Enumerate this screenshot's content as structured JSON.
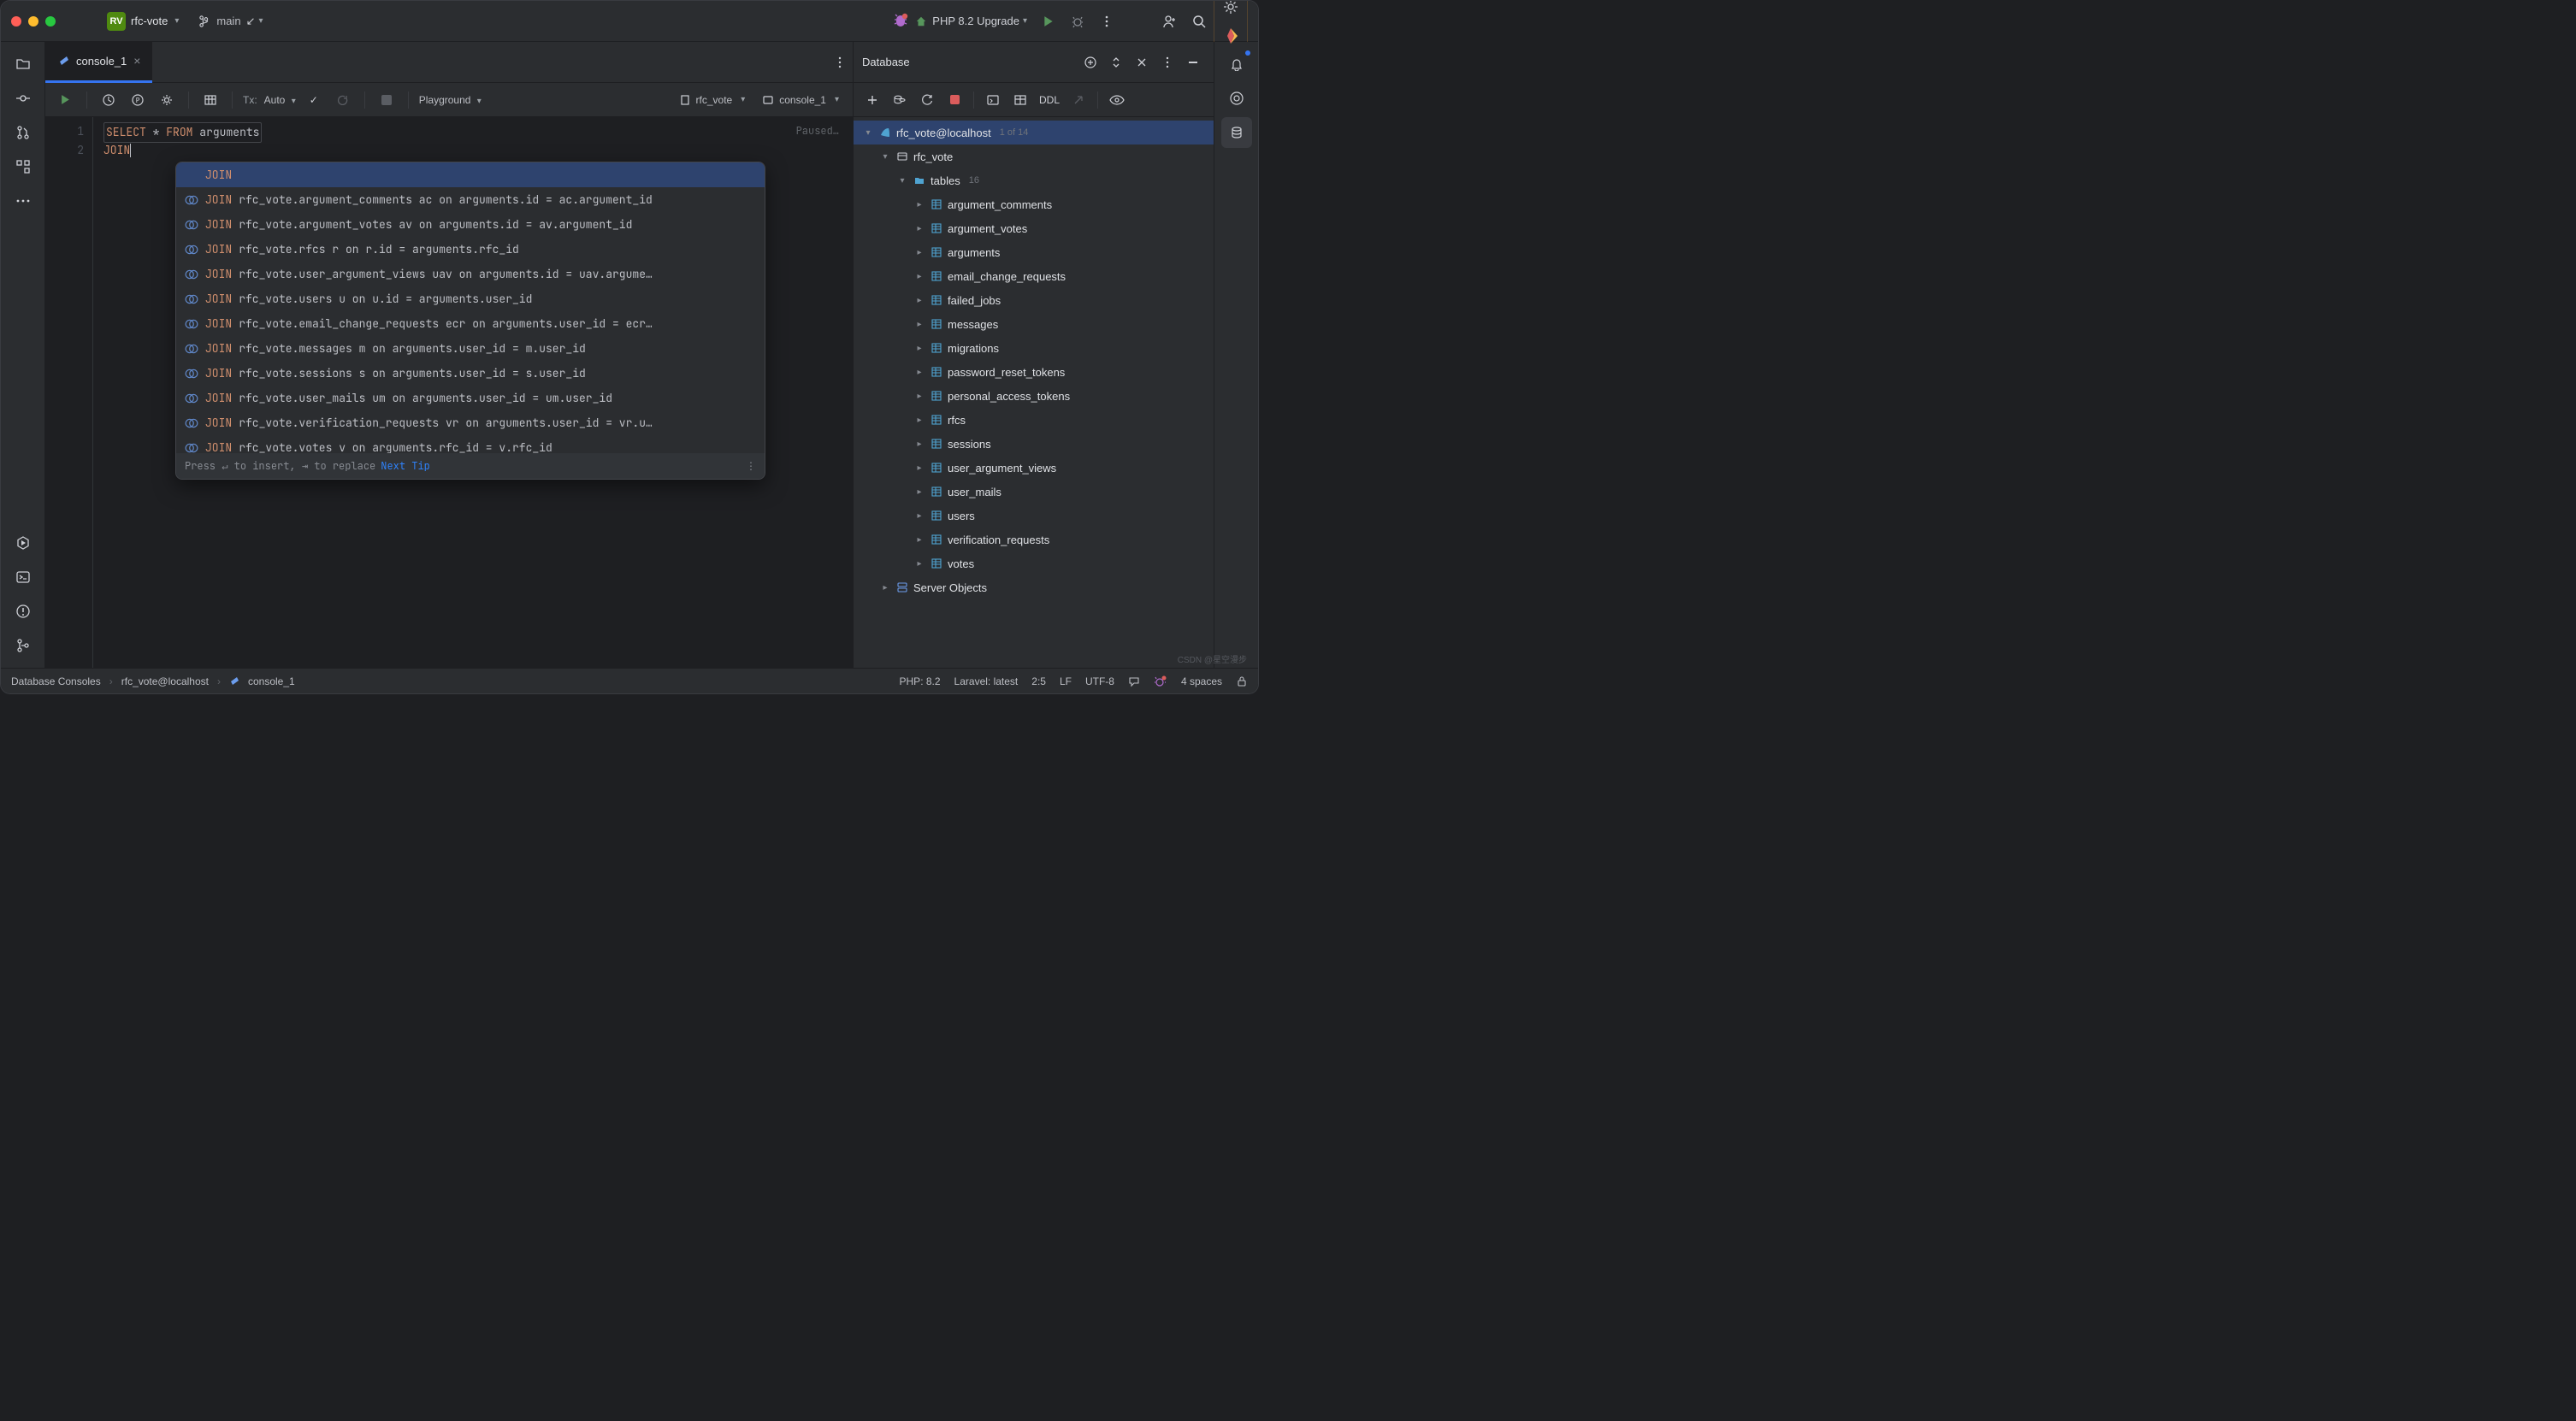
{
  "titlebar": {
    "project_initials": "RV",
    "project_name": "rfc-vote",
    "branch": "main",
    "run_config": "PHP 8.2 Upgrade"
  },
  "tabs": [
    {
      "label": "console_1"
    }
  ],
  "editor_toolbar": {
    "tx_label": "Tx:",
    "tx_mode": "Auto",
    "playground": "Playground",
    "schema": "rfc_vote",
    "session": "console_1",
    "paused": "Paused…"
  },
  "editor": {
    "line1": {
      "kw1": "SELECT",
      "star": "*",
      "kw2": "FROM",
      "tbl": "arguments"
    },
    "line2": {
      "kw": "JOIN"
    }
  },
  "autocomplete": {
    "items": [
      {
        "kw": "JOIN",
        "rest": ""
      },
      {
        "kw": "JOIN",
        "rest": "rfc_vote.argument_comments ac on arguments.id = ac.argument_id"
      },
      {
        "kw": "JOIN",
        "rest": "rfc_vote.argument_votes av on arguments.id = av.argument_id"
      },
      {
        "kw": "JOIN",
        "rest": "rfc_vote.rfcs r on r.id = arguments.rfc_id"
      },
      {
        "kw": "JOIN",
        "rest": "rfc_vote.user_argument_views uav on arguments.id = uav.argume…"
      },
      {
        "kw": "JOIN",
        "rest": "rfc_vote.users u on u.id = arguments.user_id"
      },
      {
        "kw": "JOIN",
        "rest": "rfc_vote.email_change_requests ecr on arguments.user_id = ecr…"
      },
      {
        "kw": "JOIN",
        "rest": "rfc_vote.messages m on arguments.user_id = m.user_id"
      },
      {
        "kw": "JOIN",
        "rest": "rfc_vote.sessions s on arguments.user_id = s.user_id"
      },
      {
        "kw": "JOIN",
        "rest": "rfc_vote.user_mails um on arguments.user_id = um.user_id"
      },
      {
        "kw": "JOIN",
        "rest": "rfc_vote.verification_requests vr on arguments.user_id = vr.u…"
      },
      {
        "kw": "JOIN",
        "rest": "rfc_vote.votes v on arguments.rfc_id = v.rfc_id"
      }
    ],
    "footer_hint": "Press ↵ to insert, ⇥ to replace",
    "footer_tip": "Next Tip"
  },
  "database": {
    "title": "Database",
    "datasource": "rfc_vote@localhost",
    "datasource_badge": "1 of 14",
    "schema": "rfc_vote",
    "tables_label": "tables",
    "tables_count": "16",
    "tables": [
      "argument_comments",
      "argument_votes",
      "arguments",
      "email_change_requests",
      "failed_jobs",
      "messages",
      "migrations",
      "password_reset_tokens",
      "personal_access_tokens",
      "rfcs",
      "sessions",
      "user_argument_views",
      "user_mails",
      "users",
      "verification_requests",
      "votes"
    ],
    "server_objects": "Server Objects",
    "ddl": "DDL"
  },
  "statusbar": {
    "crumb1": "Database Consoles",
    "crumb2": "rfc_vote@localhost",
    "crumb3": "console_1",
    "php": "PHP: 8.2",
    "laravel": "Laravel: latest",
    "pos": "2:5",
    "le": "LF",
    "enc": "UTF-8",
    "indent": "4 spaces"
  }
}
